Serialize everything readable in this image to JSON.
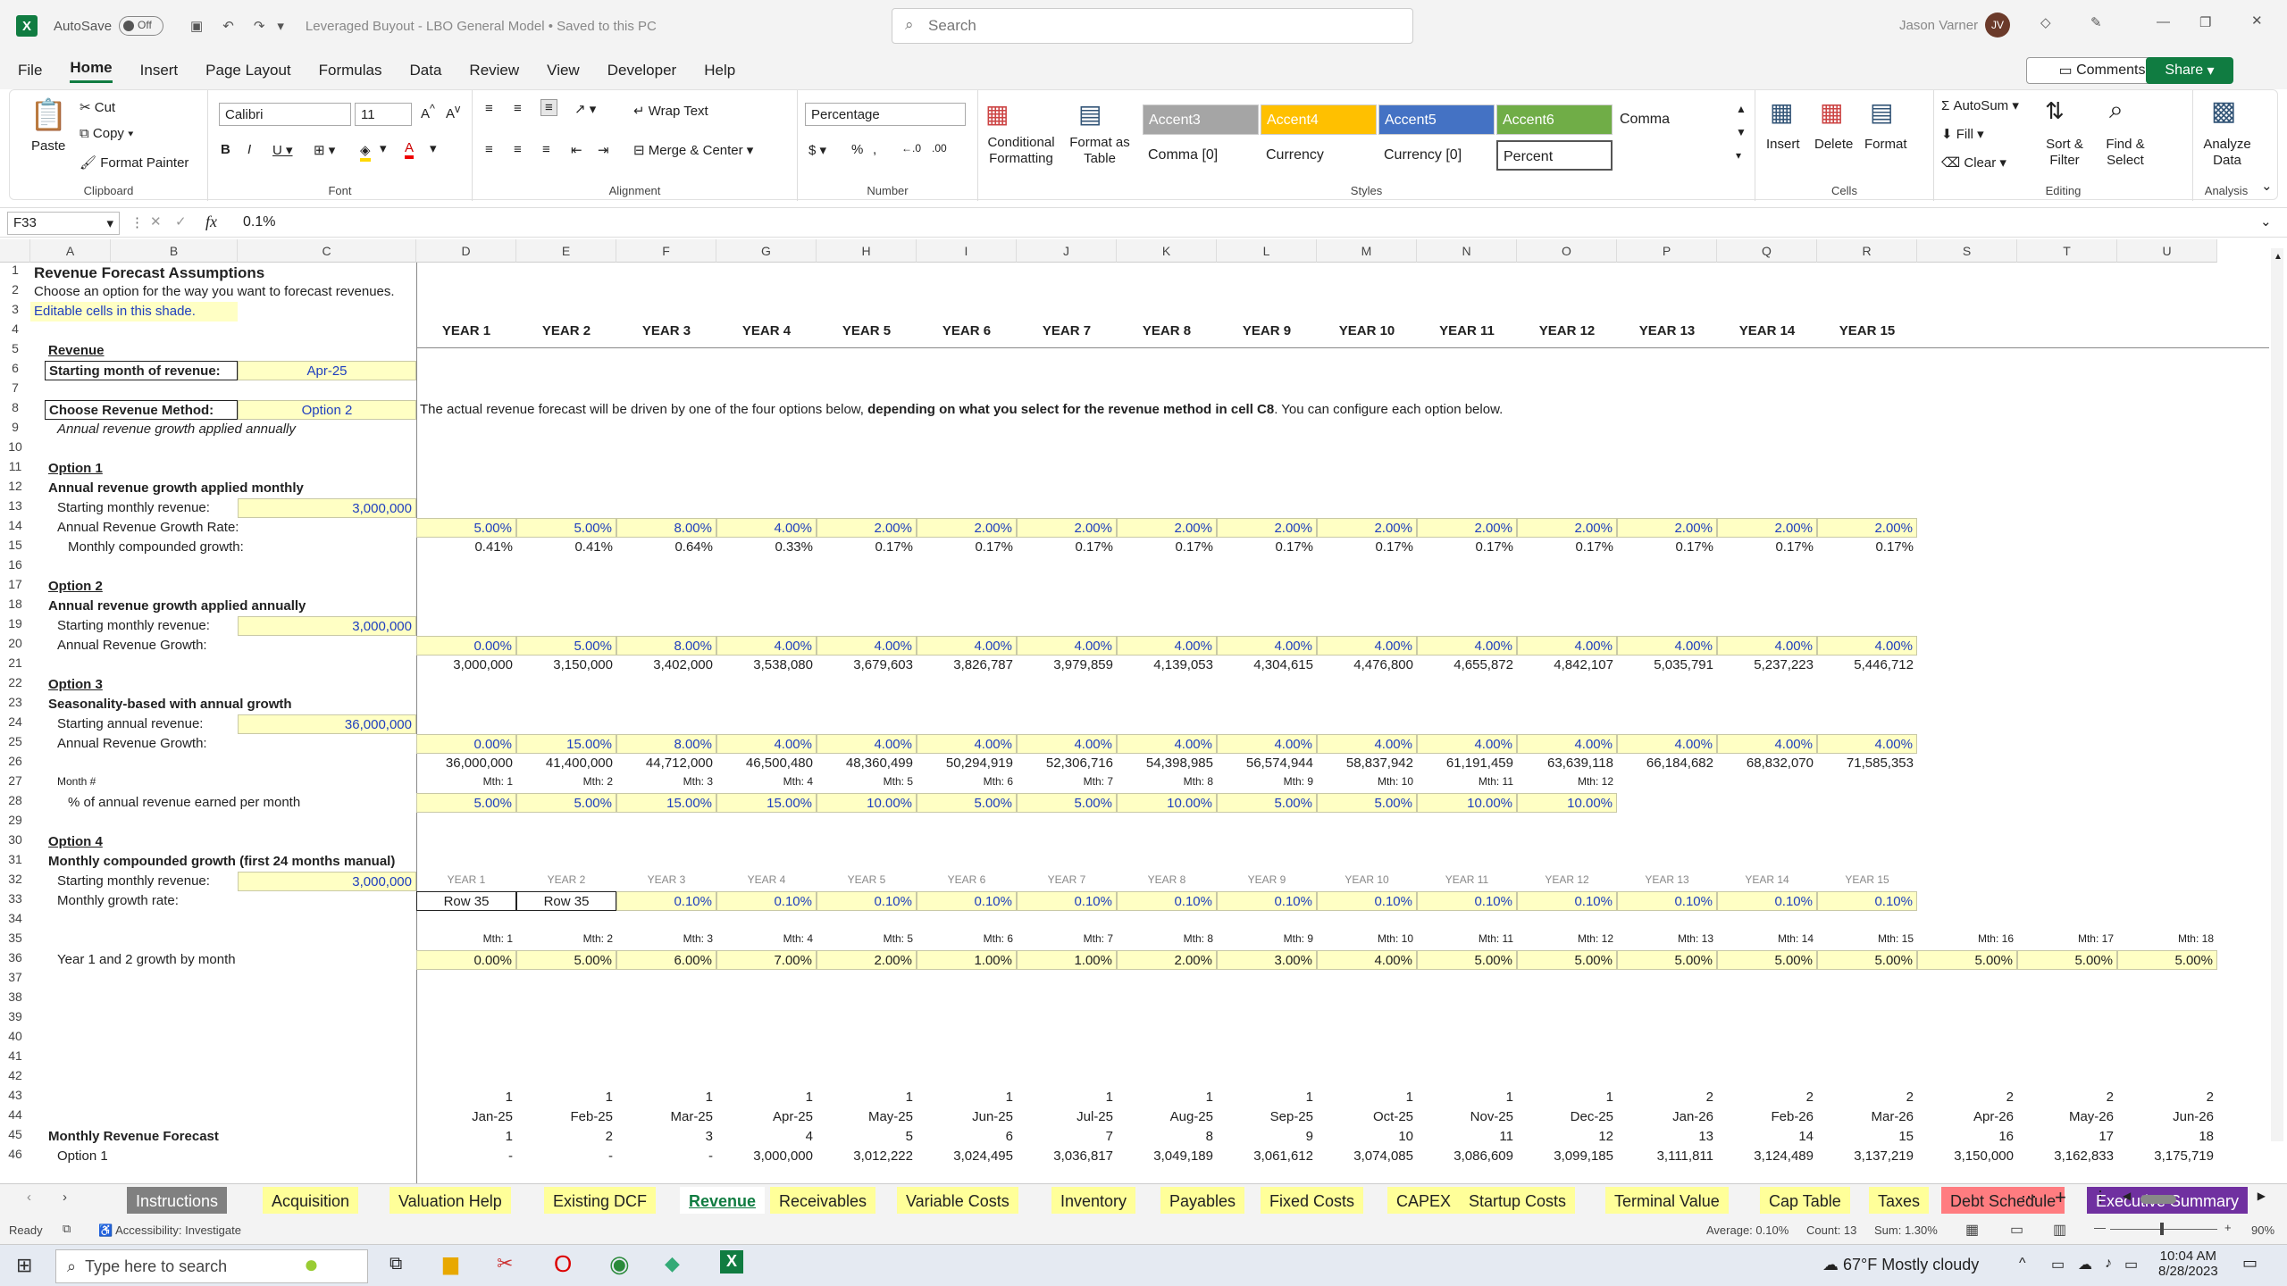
{
  "title": {
    "autosave": "AutoSave",
    "toggle": "Off",
    "doc": "Leveraged Buyout - LBO General Model • Saved to this PC",
    "search": "Search",
    "user": "Jason Varner",
    "initials": "JV"
  },
  "menu": [
    "File",
    "Home",
    "Insert",
    "Page Layout",
    "Formulas",
    "Data",
    "Review",
    "View",
    "Developer",
    "Help"
  ],
  "actions": {
    "comments": "Comments",
    "share": "Share"
  },
  "ribbon": {
    "clipboard": {
      "paste": "Paste",
      "cut": "Cut",
      "copy": "Copy",
      "format_painter": "Format Painter",
      "label": "Clipboard"
    },
    "font": {
      "name": "Calibri",
      "size": "11",
      "label": "Font"
    },
    "alignment": {
      "wrap": "Wrap Text",
      "merge": "Merge & Center",
      "label": "Alignment"
    },
    "number": {
      "format": "Percentage",
      "label": "Number"
    },
    "styles": {
      "cond": "Conditional Formatting",
      "table": "Format as Table",
      "accent3": "Accent3",
      "accent4": "Accent4",
      "accent5": "Accent5",
      "accent6": "Accent6",
      "comma": "Comma",
      "comma0": "Comma [0]",
      "currency": "Currency",
      "currency0": "Currency [0]",
      "percent": "Percent",
      "label": "Styles"
    },
    "cells": {
      "insert": "Insert",
      "delete": "Delete",
      "format": "Format",
      "label": "Cells"
    },
    "editing": {
      "autosum": "AutoSum",
      "fill": "Fill",
      "clear": "Clear",
      "sort": "Sort & Filter",
      "find": "Find & Select",
      "label": "Editing"
    },
    "analysis": {
      "analyze": "Analyze Data",
      "label": "Analysis"
    }
  },
  "formula": {
    "cell": "F33",
    "value": "0.1%"
  },
  "columns": [
    "A",
    "B",
    "C",
    "D",
    "E",
    "F",
    "G",
    "H",
    "I",
    "J",
    "K",
    "L",
    "M",
    "N",
    "O",
    "P",
    "Q",
    "R",
    "S",
    "T",
    "U"
  ],
  "rows_numbers": [
    "1",
    "2",
    "3",
    "4",
    "5",
    "6",
    "7",
    "8",
    "9",
    "10",
    "11",
    "12",
    "13",
    "14",
    "15",
    "16",
    "17",
    "18",
    "19",
    "20",
    "21",
    "22",
    "23",
    "24",
    "25",
    "26",
    "27",
    "28",
    "29",
    "30",
    "31",
    "32",
    "33",
    "34",
    "35",
    "36",
    "37",
    "38",
    "39",
    "40",
    "41",
    "42",
    "43",
    "44",
    "45",
    "46"
  ],
  "sheet": {
    "title": "Revenue Forecast Assumptions",
    "subtitle": "Choose an option for the way you want to forecast revenues.",
    "editable": "Editable cells in this shade.",
    "years": [
      "YEAR 1",
      "YEAR 2",
      "YEAR 3",
      "YEAR 4",
      "YEAR 5",
      "YEAR 6",
      "YEAR 7",
      "YEAR 8",
      "YEAR 9",
      "YEAR 10",
      "YEAR 11",
      "YEAR 12",
      "YEAR 13",
      "YEAR 14",
      "YEAR 15"
    ],
    "revenue": "Revenue",
    "start_month_label": "Starting month of revenue:",
    "start_month": "Apr-25",
    "method_label": "Choose Revenue Method:",
    "method": "Option 2",
    "method_desc": "Annual revenue growth applied annually",
    "note_a": "The actual revenue forecast will be driven by one of the four options below, ",
    "note_b": "depending on what you select for the revenue method in cell C8",
    "note_c": ". You can configure each option below.",
    "opt1": "Option 1",
    "opt1_title": "Annual revenue growth applied monthly",
    "opt1_start_label": "Starting monthly revenue:",
    "opt1_start": "3,000,000",
    "opt1_rate_label": "Annual Revenue Growth Rate:",
    "opt1_rates": [
      "5.00%",
      "5.00%",
      "8.00%",
      "4.00%",
      "2.00%",
      "2.00%",
      "2.00%",
      "2.00%",
      "2.00%",
      "2.00%",
      "2.00%",
      "2.00%",
      "2.00%",
      "2.00%",
      "2.00%"
    ],
    "opt1_monthly_label": "Monthly compounded growth:",
    "opt1_monthly": [
      "0.41%",
      "0.41%",
      "0.64%",
      "0.33%",
      "0.17%",
      "0.17%",
      "0.17%",
      "0.17%",
      "0.17%",
      "0.17%",
      "0.17%",
      "0.17%",
      "0.17%",
      "0.17%",
      "0.17%"
    ],
    "opt2": "Option 2",
    "opt2_title": "Annual revenue growth applied annually",
    "opt2_start_label": "Starting monthly revenue:",
    "opt2_start": "3,000,000",
    "opt2_growth_label": "Annual Revenue Growth:",
    "opt2_growth": [
      "0.00%",
      "5.00%",
      "8.00%",
      "4.00%",
      "4.00%",
      "4.00%",
      "4.00%",
      "4.00%",
      "4.00%",
      "4.00%",
      "4.00%",
      "4.00%",
      "4.00%",
      "4.00%",
      "4.00%"
    ],
    "opt2_values": [
      "3,000,000",
      "3,150,000",
      "3,402,000",
      "3,538,080",
      "3,679,603",
      "3,826,787",
      "3,979,859",
      "4,139,053",
      "4,304,615",
      "4,476,800",
      "4,655,872",
      "4,842,107",
      "5,035,791",
      "5,237,223",
      "5,446,712"
    ],
    "opt3": "Option 3",
    "opt3_title": "Seasonality-based with annual growth",
    "opt3_start_label": "Starting annual revenue:",
    "opt3_start": "36,000,000",
    "opt3_growth_label": "Annual Revenue Growth:",
    "opt3_growth": [
      "0.00%",
      "15.00%",
      "8.00%",
      "4.00%",
      "4.00%",
      "4.00%",
      "4.00%",
      "4.00%",
      "4.00%",
      "4.00%",
      "4.00%",
      "4.00%",
      "4.00%",
      "4.00%",
      "4.00%"
    ],
    "opt3_values": [
      "36,000,000",
      "41,400,000",
      "44,712,000",
      "46,500,480",
      "48,360,499",
      "50,294,919",
      "52,306,716",
      "54,398,985",
      "56,574,944",
      "58,837,942",
      "61,191,459",
      "63,639,118",
      "66,184,682",
      "68,832,070",
      "71,585,353"
    ],
    "month_hash": "Month #",
    "mths12": [
      "Mth: 1",
      "Mth: 2",
      "Mth: 3",
      "Mth: 4",
      "Mth: 5",
      "Mth: 6",
      "Mth: 7",
      "Mth: 8",
      "Mth: 9",
      "Mth: 10",
      "Mth: 11",
      "Mth: 12"
    ],
    "pct_label": "% of annual revenue earned per month",
    "pct": [
      "5.00%",
      "5.00%",
      "15.00%",
      "15.00%",
      "10.00%",
      "5.00%",
      "5.00%",
      "10.00%",
      "5.00%",
      "5.00%",
      "10.00%",
      "10.00%"
    ],
    "opt4": "Option 4",
    "opt4_title": "Monthly compounded growth (first 24 months manual)",
    "opt4_start_label": "Starting monthly revenue:",
    "opt4_start": "3,000,000",
    "opt4_years_small": [
      "YEAR 1",
      "YEAR 2",
      "YEAR 3",
      "YEAR 4",
      "YEAR 5",
      "YEAR 6",
      "YEAR 7",
      "YEAR 8",
      "YEAR 9",
      "YEAR 10",
      "YEAR 11",
      "YEAR 12",
      "YEAR 13",
      "YEAR 14",
      "YEAR 15"
    ],
    "opt4_rate_label": "Monthly growth rate:",
    "opt4_rates": [
      "Row 35",
      "Row 35",
      "0.10%",
      "0.10%",
      "0.10%",
      "0.10%",
      "0.10%",
      "0.10%",
      "0.10%",
      "0.10%",
      "0.10%",
      "0.10%",
      "0.10%",
      "0.10%",
      "0.10%"
    ],
    "mths18": [
      "Mth: 1",
      "Mth: 2",
      "Mth: 3",
      "Mth: 4",
      "Mth: 5",
      "Mth: 6",
      "Mth: 7",
      "Mth: 8",
      "Mth: 9",
      "Mth: 10",
      "Mth: 11",
      "Mth: 12",
      "Mth: 13",
      "Mth: 14",
      "Mth: 15",
      "Mth: 16",
      "Mth: 17",
      "Mth: 18"
    ],
    "growth_label": "Year 1 and 2 growth by month",
    "growth": [
      "0.00%",
      "5.00%",
      "6.00%",
      "7.00%",
      "2.00%",
      "1.00%",
      "1.00%",
      "2.00%",
      "3.00%",
      "4.00%",
      "5.00%",
      "5.00%",
      "5.00%",
      "5.00%",
      "5.00%",
      "5.00%",
      "5.00%",
      "5.00%"
    ],
    "row43": [
      "1",
      "1",
      "1",
      "1",
      "1",
      "1",
      "1",
      "1",
      "1",
      "1",
      "1",
      "1",
      "2",
      "2",
      "2",
      "2",
      "2",
      "2"
    ],
    "dates": [
      "Jan-25",
      "Feb-25",
      "Mar-25",
      "Apr-25",
      "May-25",
      "Jun-25",
      "Jul-25",
      "Aug-25",
      "Sep-25",
      "Oct-25",
      "Nov-25",
      "Dec-25",
      "Jan-26",
      "Feb-26",
      "Mar-26",
      "Apr-26",
      "May-26",
      "Jun-26"
    ],
    "forecast_label": "Monthly Revenue Forecast",
    "idx": [
      "1",
      "2",
      "3",
      "4",
      "5",
      "6",
      "7",
      "8",
      "9",
      "10",
      "11",
      "12",
      "13",
      "14",
      "15",
      "16",
      "17",
      "18"
    ],
    "opt1_row_label": "Option 1",
    "opt1_row": [
      "-",
      "-",
      "-",
      "3,000,000",
      "3,012,222",
      "3,024,495",
      "3,036,817",
      "3,049,189",
      "3,061,612",
      "3,074,085",
      "3,086,609",
      "3,099,185",
      "3,111,811",
      "3,124,489",
      "3,137,219",
      "3,150,000",
      "3,162,833",
      "3,175,719"
    ]
  },
  "tabs": [
    "Instructions",
    "Acquisition",
    "Valuation Help",
    "Existing DCF",
    "Revenue",
    "Receivables",
    "Variable Costs",
    "Inventory",
    "Payables",
    "Fixed Costs",
    "CAPEX",
    "Startup Costs",
    "Terminal Value",
    "Cap Table",
    "Taxes",
    "Debt Schedule",
    "Executive Summary"
  ],
  "status": {
    "ready": "Ready",
    "access": "Accessibility: Investigate",
    "avg": "Average: 0.10%",
    "count": "Count: 13",
    "sum": "Sum: 1.30%",
    "zoom": "90%"
  },
  "taskbar": {
    "search": "Type here to search",
    "weather": "67°F  Mostly cloudy",
    "time": "10:04 AM",
    "date": "8/28/2023"
  }
}
